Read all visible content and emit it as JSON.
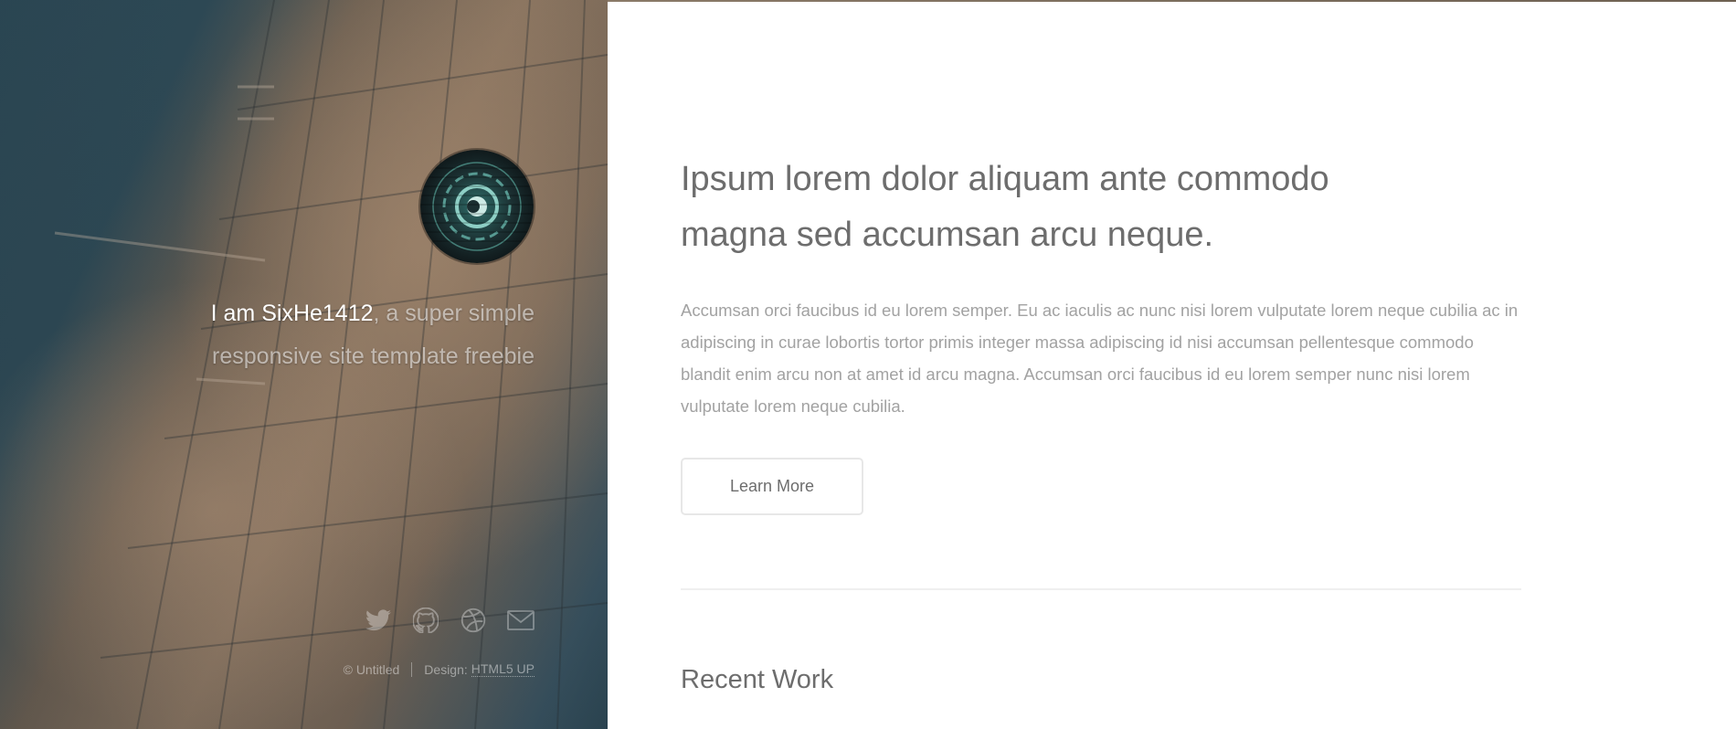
{
  "sidebar": {
    "intro_prefix": "I am ",
    "name": "SixHe1412",
    "intro_suffix": ", a super simple responsive site template freebie",
    "social_icons": [
      "twitter-icon",
      "github-icon",
      "dribbble-icon",
      "envelope-icon"
    ],
    "copyright": "© Untitled",
    "design_label": "Design:",
    "design_link": "HTML5 UP"
  },
  "main": {
    "headline": "Ipsum lorem dolor aliquam ante commodo magna sed accumsan arcu neque.",
    "body": "Accumsan orci faucibus id eu lorem semper. Eu ac iaculis ac nunc nisi lorem vulputate lorem neque cubilia ac in adipiscing in curae lobortis tortor primis integer massa adipiscing id nisi accumsan pellentesque commodo blandit enim arcu non at amet id arcu magna. Accumsan orci faucibus id eu lorem semper nunc nisi lorem vulputate lorem neque cubilia.",
    "button_label": "Learn More",
    "section_title": "Recent Work"
  },
  "colors": {
    "heading": "#6d6d6d",
    "body": "#a2a2a2",
    "sidebar_water": "#2c4855",
    "sidebar_buildings": "#8f7862"
  }
}
